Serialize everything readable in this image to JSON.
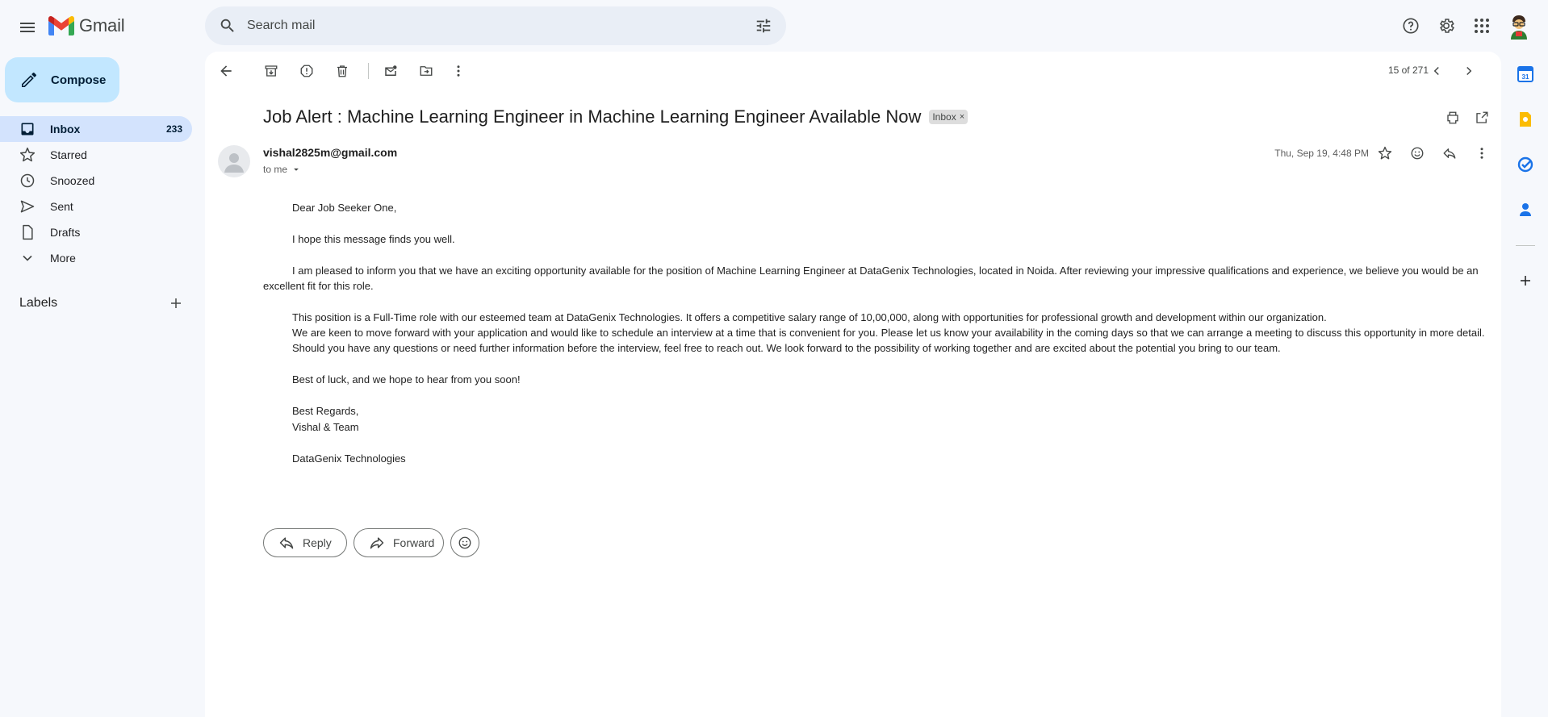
{
  "header": {
    "app_name": "Gmail",
    "search_placeholder": "Search mail"
  },
  "sidebar": {
    "compose_label": "Compose",
    "items": [
      {
        "label": "Inbox",
        "count": "233",
        "icon": "inbox-icon"
      },
      {
        "label": "Starred",
        "count": "",
        "icon": "star-icon"
      },
      {
        "label": "Snoozed",
        "count": "",
        "icon": "clock-icon"
      },
      {
        "label": "Sent",
        "count": "",
        "icon": "send-icon"
      },
      {
        "label": "Drafts",
        "count": "",
        "icon": "draft-icon"
      },
      {
        "label": "More",
        "count": "",
        "icon": "chevron-down-icon"
      }
    ],
    "labels_title": "Labels"
  },
  "toolbar": {
    "counter": "15 of 271"
  },
  "email": {
    "subject": "Job Alert : Machine Learning Engineer in Machine Learning Engineer Available Now",
    "label_chip": "Inbox",
    "sender": "vishal2825m@gmail.com",
    "recipient": "to me",
    "date": "Thu, Sep 19, 4:48 PM",
    "body": {
      "greeting": "Dear Job Seeker One,",
      "line1": "I hope this message finds you well.",
      "para1_line1": "I am pleased to inform you that we have an exciting opportunity available for the position of Machine Learning Engineer at DataGenix Technologies, located in Noida. After reviewing your impressive qualifications and experience, we believe you would be an",
      "para1_line2": "excellent fit for this role.",
      "para2_line1": "This position is a Full-Time role with our esteemed team at DataGenix Technologies. It offers a competitive salary range of 10,00,000, along with opportunities for professional growth and development within our organization.",
      "para2_line2": "We are keen to move forward with your application and would like to schedule an interview at a time that is convenient for you. Please let us know your availability in the coming days so that we can arrange a meeting to discuss this opportunity in more detail.",
      "para2_line3": "Should you have any questions or need further information before the interview, feel free to reach out. We look forward to the possibility of working together and are excited about the potential you bring to our team.",
      "closing": "Best of luck, and we hope to hear from you soon!",
      "regards": "Best Regards,",
      "signature": "Vishal & Team",
      "company": "DataGenix Technologies"
    },
    "reply_label": "Reply",
    "forward_label": "Forward"
  },
  "colors": {
    "background": "#f6f8fc",
    "compose": "#c2e7ff",
    "active_nav": "#d3e3fd",
    "search": "#e9eef6"
  }
}
